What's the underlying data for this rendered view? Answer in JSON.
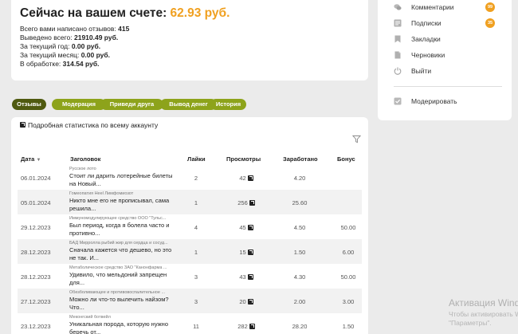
{
  "balance": {
    "title_prefix": "Сейчас на вашем счете: ",
    "amount": "62.93 руб.",
    "lines": [
      {
        "label": "Всего вами написано отзывов: ",
        "value": "415"
      },
      {
        "label": "Выведено всего: ",
        "value": "21910.49 руб."
      },
      {
        "label": "За текущий год: ",
        "value": "0.00 руб."
      },
      {
        "label": "За текущий месяц: ",
        "value": "0.00 руб."
      },
      {
        "label": "В обработке: ",
        "value": "314.54 руб."
      }
    ]
  },
  "tabs": [
    {
      "label": "Отзывы",
      "active": true
    },
    {
      "label": "Модерация",
      "active": false
    },
    {
      "label": "Приведи друга",
      "active": false
    },
    {
      "label": "Вывод денег",
      "active": false
    },
    {
      "label": "История",
      "active": false
    }
  ],
  "table": {
    "stats_link": "Подробная статистика по всему аккаунту",
    "headers": {
      "date": "Дата",
      "title": "Заголовок",
      "likes": "Лайки",
      "views": "Просмотры",
      "earned": "Заработано",
      "bonus": "Бонус"
    },
    "rows": [
      {
        "date": "06.01.2024",
        "category": "Русское лото",
        "title": "Стоит ли дарить лотерейные билеты на Новый...",
        "likes": "2",
        "views": "42",
        "earned": "4.20",
        "bonus": ""
      },
      {
        "date": "05.01.2024",
        "category": "Гомеопатия Heel Лимфомиозот",
        "title": "Никто мне его не прописывал, сама решила...",
        "likes": "1",
        "views": "256",
        "earned": "25.60",
        "bonus": ""
      },
      {
        "date": "29.12.2023",
        "category": "Иммуномодулирующее средство ООО \"Тульс...",
        "title": "Был период, когда я болела часто и противно...",
        "likes": "4",
        "views": "45",
        "earned": "4.50",
        "bonus": "50.00"
      },
      {
        "date": "28.12.2023",
        "category": "БАД Мирролла рыбий жир для сердца и сосуд...",
        "title": "Сначала кажется что дешево, но это не так. И...",
        "likes": "1",
        "views": "15",
        "earned": "1.50",
        "bonus": "6.00"
      },
      {
        "date": "28.12.2023",
        "category": "Метаболическое средство ЗАО \"Канонфарма ...",
        "title": "Удивило, что мельдоний запрещен для...",
        "likes": "3",
        "views": "43",
        "earned": "4.30",
        "bonus": "50.00"
      },
      {
        "date": "27.12.2023",
        "category": "Обезболивающее и противовоспалительное ...",
        "title": "Можно ли что-то вылечить найзом? Что...",
        "likes": "3",
        "views": "20",
        "earned": "2.00",
        "bonus": "3.00"
      },
      {
        "date": "23.12.2023",
        "category": "Меконгский ботвейл",
        "title": "Уникальная порода, которую нужно беречь от...",
        "likes": "11",
        "views": "282",
        "earned": "28.20",
        "bonus": "1.50"
      }
    ]
  },
  "sidebar": {
    "items": [
      {
        "label": "Комментарии",
        "icon": "comments-icon",
        "badge": "99"
      },
      {
        "label": "Подписки",
        "icon": "subscriptions-icon",
        "badge": "35"
      },
      {
        "label": "Закладки",
        "icon": "bookmark-icon",
        "badge": ""
      },
      {
        "label": "Черновики",
        "icon": "draft-icon",
        "badge": ""
      },
      {
        "label": "Выйти",
        "icon": "power-icon",
        "badge": ""
      }
    ],
    "moderate": {
      "label": "Модерировать",
      "icon": "moderate-check-icon"
    }
  },
  "watermark": {
    "title": "Активация Wind",
    "line1": "Чтобы активировать Windo",
    "line2": "\"Параметры\"."
  },
  "colors": {
    "accent": "#f0a020",
    "tab": "#8da31b",
    "tab_active": "#4f5a10",
    "background": "#ebebeb"
  }
}
